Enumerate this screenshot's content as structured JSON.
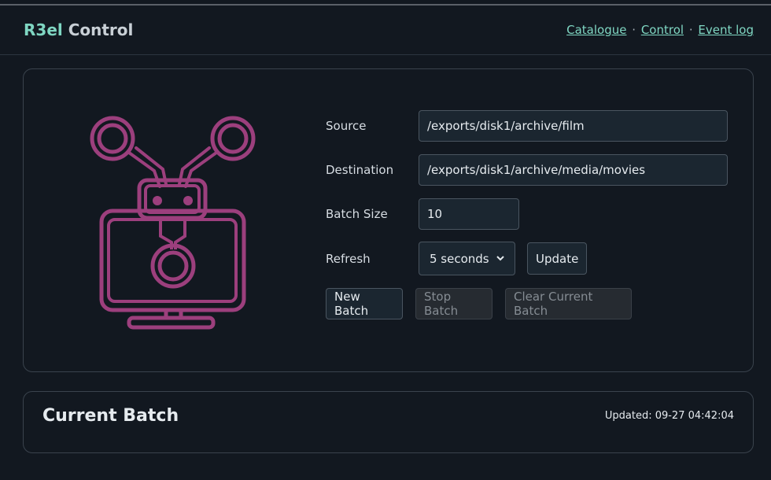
{
  "header": {
    "brand_first": "R3el",
    "brand_second": " Control",
    "nav": [
      {
        "label": "Catalogue"
      },
      {
        "label": "Control"
      },
      {
        "label": "Event log"
      }
    ],
    "separator": "·"
  },
  "form": {
    "source_label": "Source",
    "source_value": "/exports/disk1/archive/film",
    "destination_label": "Destination",
    "destination_value": "/exports/disk1/archive/media/movies",
    "batch_size_label": "Batch Size",
    "batch_size_value": "10",
    "refresh_label": "Refresh",
    "refresh_value": "5 seconds",
    "update_button": "Update",
    "new_batch_button": "New Batch",
    "stop_batch_button": "Stop Batch",
    "clear_batch_button": "Clear Current Batch"
  },
  "batch": {
    "title": "Current Batch",
    "updated": "Updated: 09-27 04:42:04"
  },
  "colors": {
    "accent": "#7fd6c2",
    "logo": "#9c3f7d",
    "background": "#121820"
  },
  "icons": {
    "logo": "robot-projector-icon",
    "select_arrow": "chevron-down-icon"
  }
}
